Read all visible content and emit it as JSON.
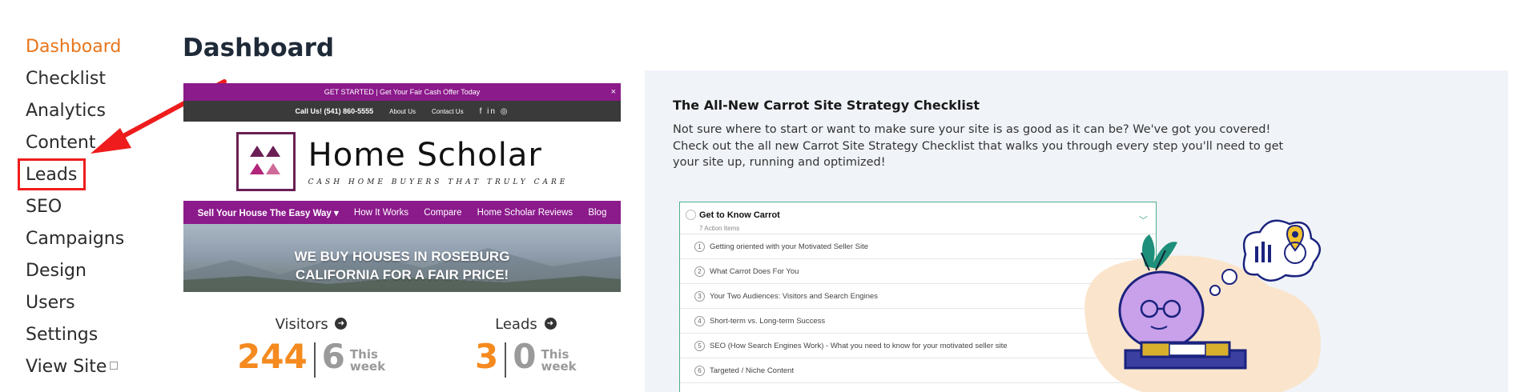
{
  "sidebar": {
    "items": [
      {
        "label": "Dashboard",
        "active": true
      },
      {
        "label": "Checklist"
      },
      {
        "label": "Analytics"
      },
      {
        "label": "Content"
      },
      {
        "label": "Leads",
        "highlighted": true
      },
      {
        "label": "SEO"
      },
      {
        "label": "Campaigns"
      },
      {
        "label": "Design"
      },
      {
        "label": "Users"
      },
      {
        "label": "Settings"
      },
      {
        "label": "View Site",
        "icon": "external-link-icon"
      }
    ]
  },
  "page": {
    "title": "Dashboard"
  },
  "preview": {
    "banner": "GET STARTED | Get Your Fair Cash Offer Today",
    "close": "×",
    "call": "Call Us! (541) 860-5555",
    "about": "About Us",
    "contact": "Contact Us",
    "social": "f in ◎",
    "brand": "Home Scholar",
    "tagline": "CASH HOME BUYERS THAT TRULY CARE",
    "nav": [
      "Sell Your House The Easy Way ▾",
      "How It Works",
      "Compare",
      "Home Scholar Reviews",
      "Blog"
    ],
    "hero_line1": "WE BUY HOUSES IN ROSEBURG",
    "hero_line2": "CALIFORNIA FOR A FAIR PRICE!"
  },
  "stats": {
    "visitors": {
      "label": "Visitors",
      "total": "244",
      "week": "6",
      "this": "This",
      "week_label": "week"
    },
    "leads": {
      "label": "Leads",
      "total": "3",
      "week": "0",
      "this": "This",
      "week_label": "week"
    }
  },
  "checklist_card": {
    "title": "The All-New Carrot Site Strategy Checklist",
    "description": "Not sure where to start or want to make sure your site is as good as it can be? We've got you covered! Check out the all new Carrot Site Strategy Checklist that walks you through every step you'll need to get your site up, running and optimized!",
    "preview": {
      "heading": "Get to Know Carrot",
      "subheading": "7 Action Items",
      "items": [
        {
          "n": "1",
          "text": "Getting oriented with your Motivated Seller Site"
        },
        {
          "n": "2",
          "text": "What Carrot Does For You"
        },
        {
          "n": "3",
          "text": "Your Two Audiences: Visitors and Search Engines"
        },
        {
          "n": "4",
          "text": "Short-term vs. Long-term Success"
        },
        {
          "n": "5",
          "text": "SEO (How Search Engines Work) - What you need to know for your motivated seller site"
        },
        {
          "n": "6",
          "text": "Targeted / Niche Content"
        }
      ]
    }
  },
  "colors": {
    "accent": "#e8751a",
    "highlight_red": "#ee1c1c",
    "brand_purple": "#8b1a8b",
    "stat_orange": "#f58a1f"
  }
}
